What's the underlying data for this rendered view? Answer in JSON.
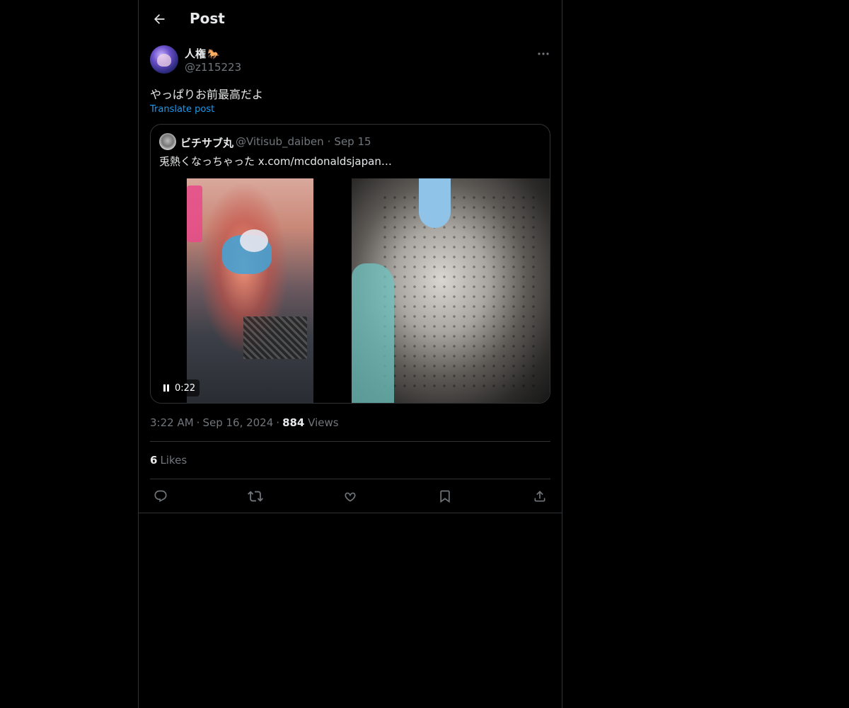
{
  "header": {
    "title": "Post",
    "back_icon": "arrow-left-icon"
  },
  "post": {
    "author": {
      "display_name": "人権",
      "emoji": "🐎",
      "handle": "@z115223"
    },
    "text": "やっぱりお前最高だよ",
    "translate_label": "Translate post",
    "quote": {
      "display_name": "ビチサブ丸",
      "handle": "@Vitisub_daiben",
      "separator": "·",
      "date": "Sep 15",
      "text": "兎熱くなっちゃった x.com/mcdonaldsjapan…",
      "video_time": "0:22"
    },
    "time": "3:22 AM",
    "date": "Sep 16, 2024",
    "separator": "·",
    "views_count": "884",
    "views_label": "Views",
    "likes_count": "6",
    "likes_label": "Likes"
  },
  "actions": [
    "reply-icon",
    "repost-icon",
    "like-icon",
    "bookmark-icon",
    "share-icon"
  ],
  "colors": {
    "background": "#000000",
    "text": "#e7e9ea",
    "secondary": "#71767b",
    "accent": "#1d9bf0",
    "border": "#2f3336"
  }
}
